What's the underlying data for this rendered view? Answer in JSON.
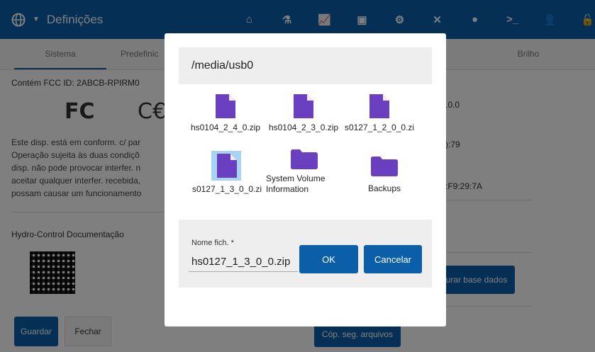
{
  "app": {
    "title": "Definições",
    "globe_icon": "globe-icon",
    "caret_icon": "caret-down-icon"
  },
  "nav_icons": [
    "home-icon",
    "flask-icon",
    "chart-icon",
    "toolbox-icon",
    "gear-icon",
    "tools-icon",
    "toggle-icon",
    "terminal-icon",
    "user-icon",
    "unlock-icon"
  ],
  "tabs": {
    "sistema": "Sistema",
    "predefinicoes": "Predefinic",
    "brilho": "Brilho"
  },
  "left": {
    "fcc_title": "Contém FCC ID: 2ABCB-RPIRM0",
    "fcc_logo": "FC",
    "ce_logo": "C€",
    "compliance": "Este disp. está em conform. c/ par\nOperação sujeita às duas condiçõ\ndisp. não pode provocar interfer. n\naceitar qualquer interfer. recebida,\npossam causar um funcionamento",
    "doc_title": "Hydro-Control Documentação"
  },
  "right": {
    "v1": ".0.0",
    "v2": "):79",
    "v3": ":F9:29:7A",
    "restore_btn": "urar base dados",
    "backup_btn": "Cóp. seg. arquivos"
  },
  "buttons": {
    "save": "Guardar",
    "close": "Fechar"
  },
  "dialog": {
    "path": "/media/usb0",
    "files": [
      {
        "name": "hs0104_2_4_0.zip",
        "icon": "file-icon"
      },
      {
        "name": "hs0104_2_3_0.zip",
        "icon": "file-icon"
      },
      {
        "name": "s0127_1_2_0_0.zi",
        "icon": "file-icon"
      },
      {
        "name": "s0127_1_3_0_0.zi",
        "icon": "file-icon"
      },
      {
        "name": "System Volume Information",
        "icon": "folder-icon"
      },
      {
        "name": "Backups",
        "icon": "folder-icon"
      }
    ],
    "filename_label": "Nome fich. *",
    "filename_value": "hs0127_1_3_0_0.zip",
    "ok": "OK",
    "cancel": "Cancelar"
  },
  "colors": {
    "primary": "#0a5fa8",
    "icon_purple": "#6a3fc0",
    "selection": "#a7d3f5"
  }
}
